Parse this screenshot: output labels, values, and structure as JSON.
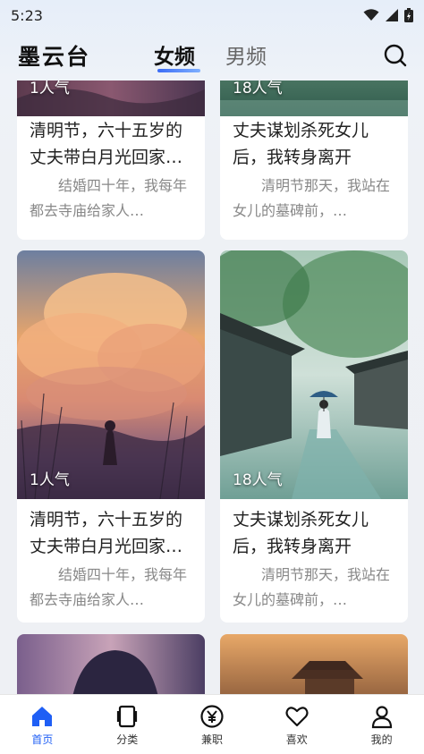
{
  "status": {
    "time": "5:23"
  },
  "header": {
    "app_title": "墨云台",
    "tabs": [
      {
        "label": "女频",
        "active": true
      },
      {
        "label": "男频",
        "active": false
      }
    ],
    "search_icon": "search-icon"
  },
  "cards": [
    {
      "popularity": "1人气",
      "title": "清明节，六十五岁的丈夫带白月光回家…",
      "desc": "结婚四十年，我每年都去寺庙给家人…"
    },
    {
      "popularity": "18人气",
      "title": "丈夫谋划杀死女儿后，我转身离开",
      "desc": "清明节那天，我站在女儿的墓碑前，…"
    },
    {
      "popularity": "1人气",
      "title": "清明节，六十五岁的丈夫带白月光回家…",
      "desc": "结婚四十年，我每年都去寺庙给家人…"
    },
    {
      "popularity": "18人气",
      "title": "丈夫谋划杀死女儿后，我转身离开",
      "desc": "清明节那天，我站在女儿的墓碑前，…"
    }
  ],
  "nav": [
    {
      "label": "首页",
      "icon": "home-icon",
      "active": true
    },
    {
      "label": "分类",
      "icon": "category-icon",
      "active": false
    },
    {
      "label": "兼职",
      "icon": "yen-icon",
      "active": false
    },
    {
      "label": "喜欢",
      "icon": "heart-icon",
      "active": false
    },
    {
      "label": "我的",
      "icon": "person-icon",
      "active": false
    }
  ],
  "colors": {
    "accent": "#1f5ff5"
  }
}
